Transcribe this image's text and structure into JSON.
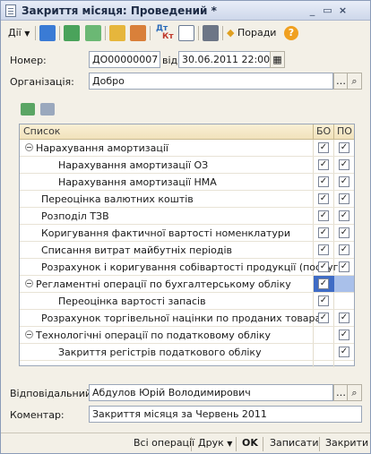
{
  "window": {
    "title": "Закриття місяця: Проведений *"
  },
  "toolbar": {
    "actions_label": "Дії",
    "tips_label": "Поради",
    "dtkt_label_top": "Дт",
    "dtkt_label_bottom": "Кт"
  },
  "header": {
    "number_label": "Номер:",
    "number_value": "ДО00000007",
    "date_label": "від:",
    "date_value": "30.06.2011 22:00:00",
    "org_label": "Організація:",
    "org_value": "Добро"
  },
  "grid": {
    "columns": [
      "Список",
      "БО",
      "ПО"
    ],
    "rows": [
      {
        "label": "Нарахування амортизації",
        "level": 0,
        "group": true,
        "bo": true,
        "po": true
      },
      {
        "label": "Нарахування амортизації ОЗ",
        "level": 2,
        "group": false,
        "bo": true,
        "po": true
      },
      {
        "label": "Нарахування амортизації НМА",
        "level": 2,
        "group": false,
        "bo": true,
        "po": true
      },
      {
        "label": "Переоцінка валютних коштів",
        "level": 1,
        "group": false,
        "bo": true,
        "po": true
      },
      {
        "label": "Розподіл ТЗВ",
        "level": 1,
        "group": false,
        "bo": true,
        "po": true
      },
      {
        "label": "Коригування фактичної вартості номенклатури",
        "level": 1,
        "group": false,
        "bo": true,
        "po": true
      },
      {
        "label": "Списання витрат майбутніх періодів",
        "level": 1,
        "group": false,
        "bo": true,
        "po": true
      },
      {
        "label": "Розрахунок і коригування собівартості продукції (послуг)",
        "level": 1,
        "group": false,
        "bo": true,
        "po": true
      },
      {
        "label": "Регламентні операції по бухгалтерському обліку",
        "level": 0,
        "group": true,
        "bo": true,
        "po": null
      },
      {
        "label": "Переоцінка вартості запасів",
        "level": 2,
        "group": false,
        "bo": true,
        "po": null
      },
      {
        "label": "Розрахунок торгівельної націнки по проданих товарах",
        "level": 1,
        "group": false,
        "bo": true,
        "po": true
      },
      {
        "label": "Технологічні операції по податковому обліку",
        "level": 0,
        "group": true,
        "bo": null,
        "po": true
      },
      {
        "label": "Закриття регістрів податкового обліку",
        "level": 2,
        "group": false,
        "bo": null,
        "po": true
      }
    ]
  },
  "footer": {
    "responsible_label": "Відповідальний:",
    "responsible_value": "Абдулов Юрій Володимирович",
    "comment_label": "Коментар:",
    "comment_value": "Закриття місяця за Червень 2011"
  },
  "bottom_bar": {
    "all_ops": "Всі операції",
    "print": "Друк",
    "ok": "OK",
    "write": "Записати",
    "close": "Закрити"
  },
  "colors": {
    "selection": "#3f6cc5",
    "header_bg": "#f1e2bb"
  }
}
